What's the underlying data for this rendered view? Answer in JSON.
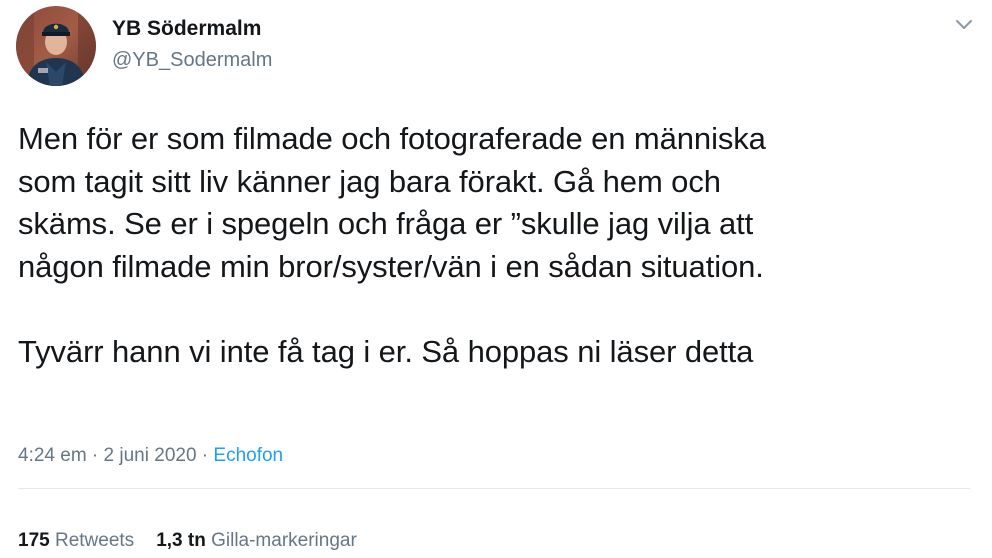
{
  "user": {
    "display_name": "YB Södermalm",
    "handle": "@YB_Sodermalm",
    "avatar_icon": "police-officer-avatar"
  },
  "menu": {
    "icon": "chevron-down-icon"
  },
  "tweet": {
    "text": "Men för er som filmade och fotograferade en människa\nsom tagit sitt liv känner jag bara förakt. Gå hem och\nskäms. Se er i spegeln och fråga er ”skulle jag vilja att\nnågon filmade min bror/syster/vän i en sådan situation.\n\nTyvärr hann vi inte få tag i er. Så hoppas ni läser detta"
  },
  "meta": {
    "time": "4:24 em",
    "separator": " · ",
    "date": "2 juni 2020",
    "separator2": " · ",
    "source": "Echofon"
  },
  "stats": {
    "retweets_count": "175",
    "retweets_label": "Retweets",
    "likes_count": "1,3 tn",
    "likes_label": "Gilla-markeringar"
  },
  "colors": {
    "text": "#14171a",
    "secondary": "#657786",
    "link": "#1da1f2",
    "divider": "#e1e8ed"
  }
}
